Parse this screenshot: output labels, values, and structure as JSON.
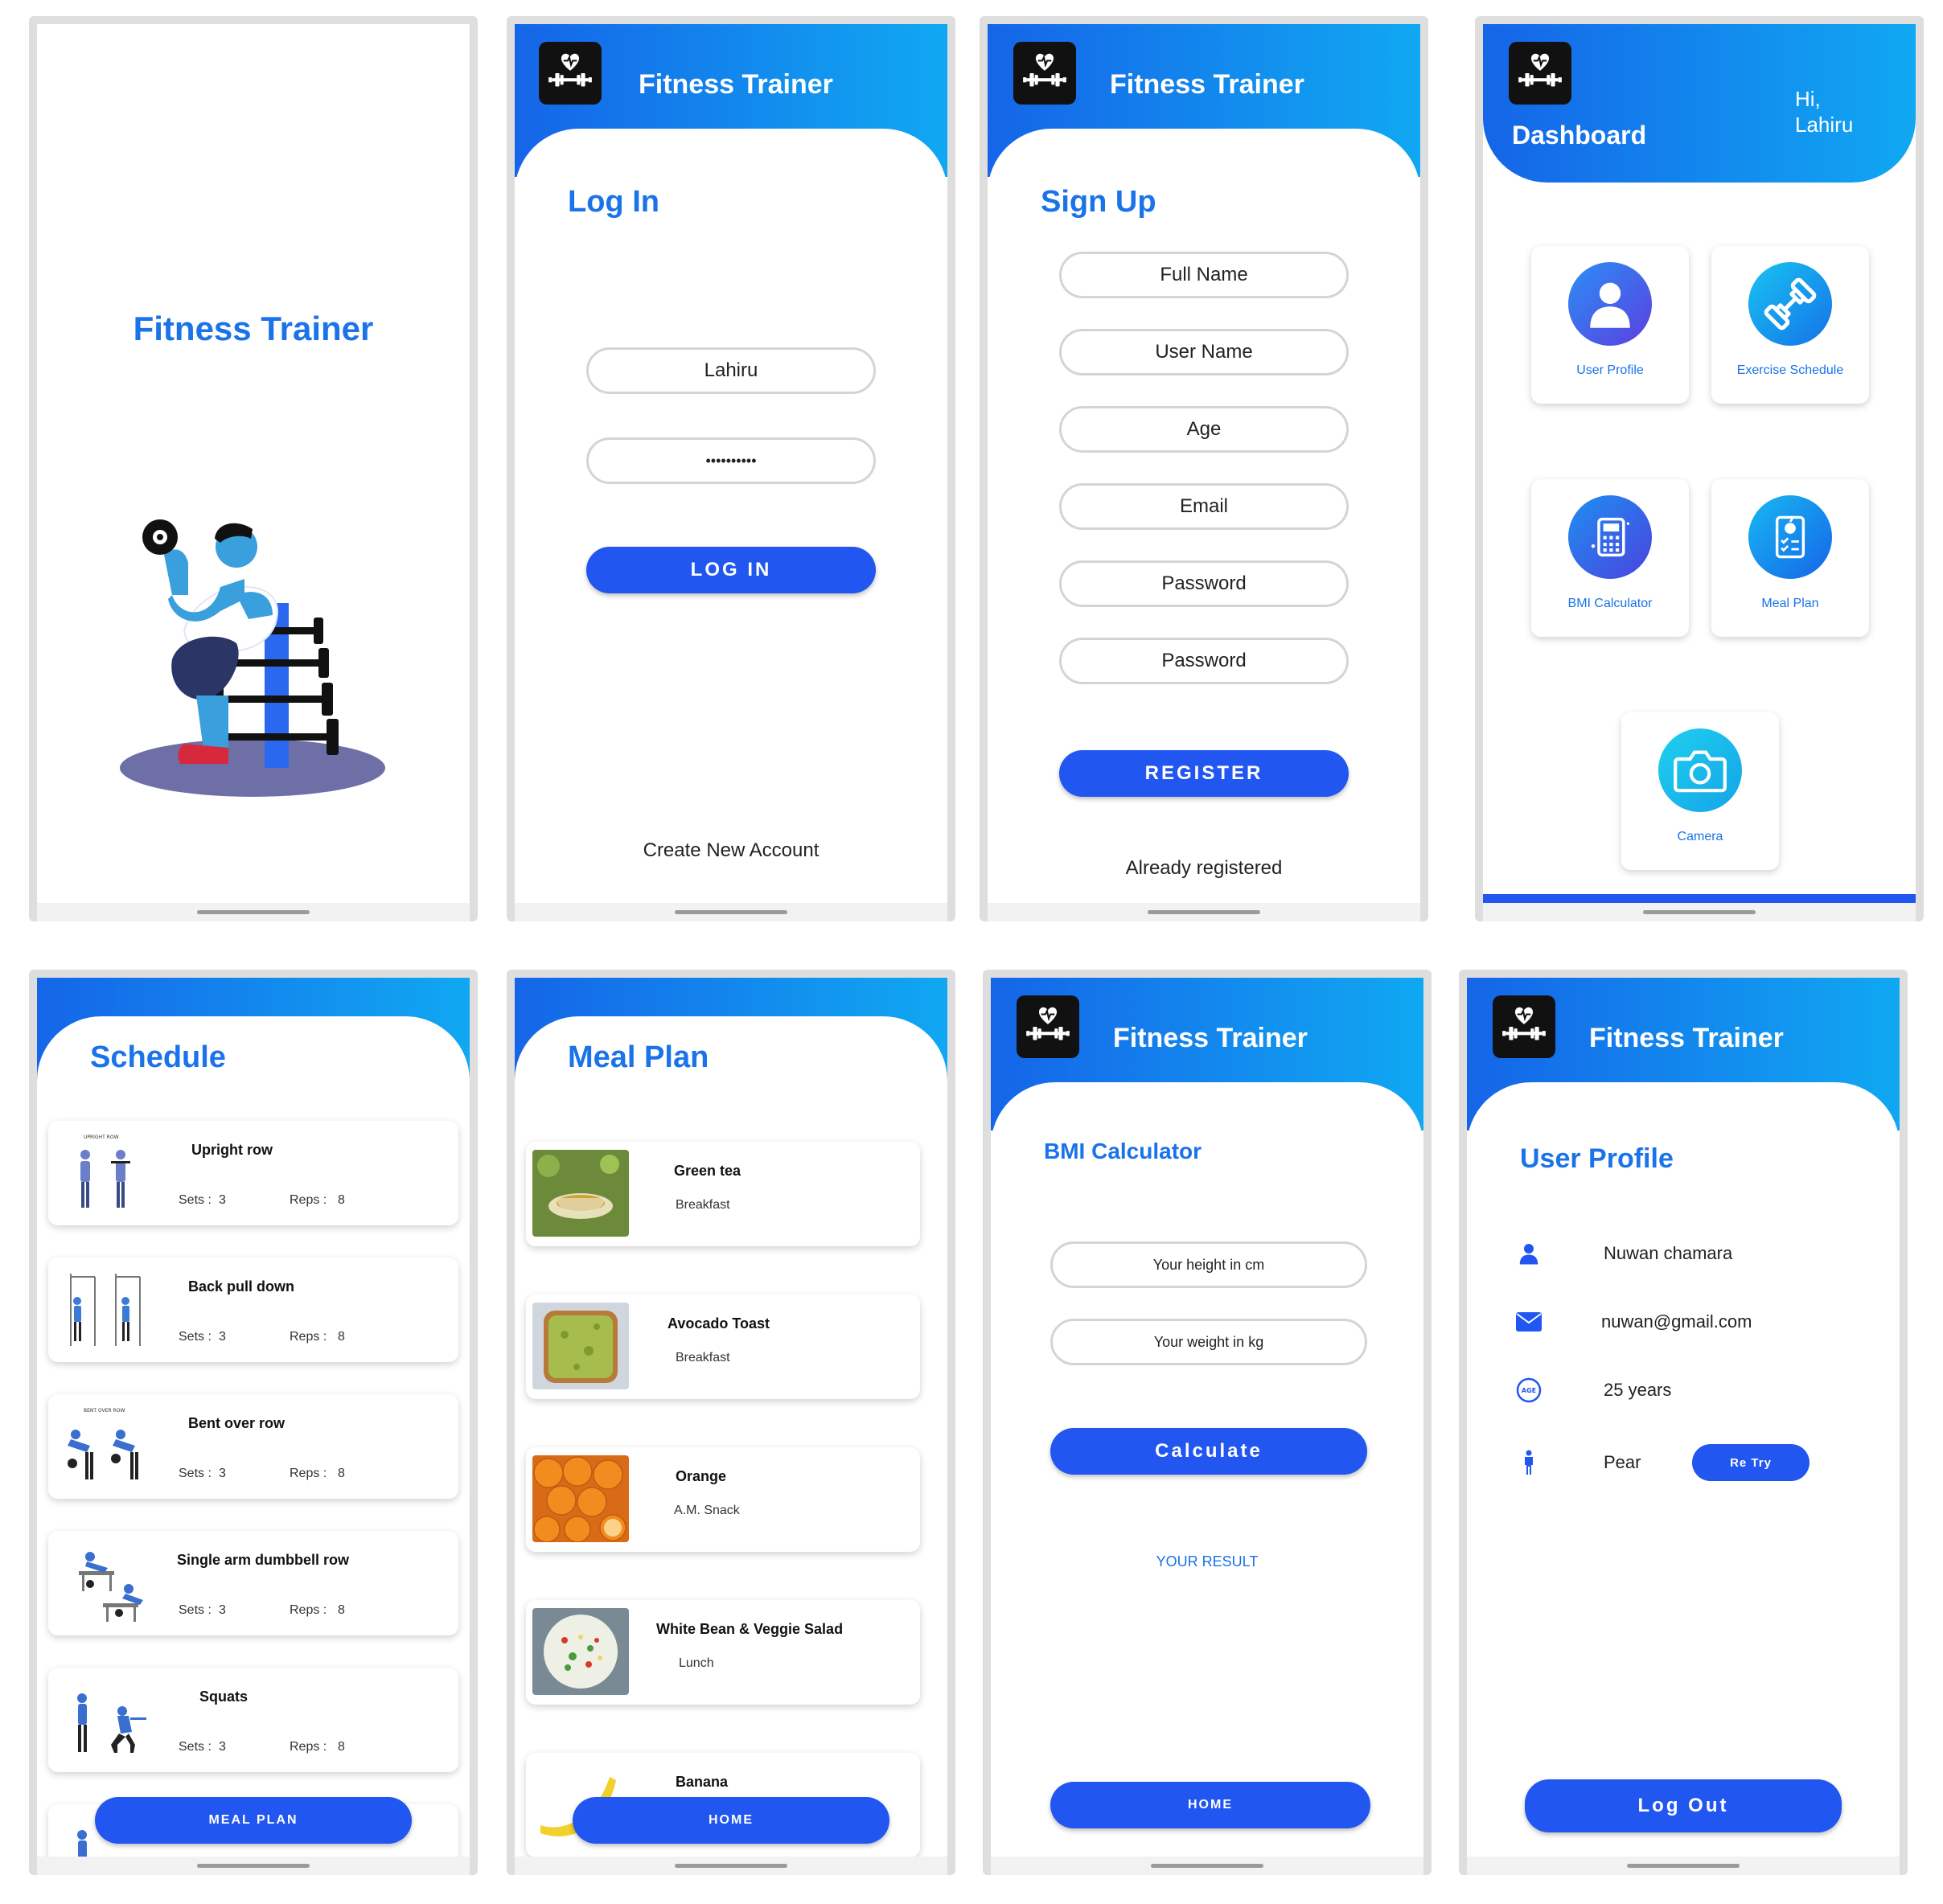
{
  "app_title": "Fitness Trainer",
  "colors": {
    "brand_blue": "#1a73e8",
    "button_blue": "#2156f0",
    "gradient_start": "#1565e8",
    "gradient_end": "#10a8f2"
  },
  "splash": {
    "title": "Fitness Trainer",
    "illustration": "man-lifting-dumbbell-illustration"
  },
  "login": {
    "heading": "Log In",
    "username_value": "Lahiru",
    "password_value": "••••••••••",
    "login_button": "LOG IN",
    "create_account": "Create New Account"
  },
  "signup": {
    "heading": "Sign Up",
    "fields": [
      "Full Name",
      "User Name",
      "Age",
      "Email",
      "Password",
      "Password"
    ],
    "register_button": "REGISTER",
    "already_registered": "Already registered"
  },
  "dashboard": {
    "title": "Dashboard",
    "greeting_hi": "Hi,",
    "greeting_name": "Lahiru",
    "tiles": [
      {
        "label": "User Profile",
        "icon": "user-icon"
      },
      {
        "label": "Exercise Schedule",
        "icon": "dumbbell-icon"
      },
      {
        "label": "BMI Calculator",
        "icon": "calculator-icon"
      },
      {
        "label": "Meal Plan",
        "icon": "clipboard-apple-icon"
      },
      {
        "label": "Camera",
        "icon": "camera-icon"
      }
    ]
  },
  "schedule": {
    "heading": "Schedule",
    "sets_label": "Sets :",
    "reps_label": "Reps :",
    "items": [
      {
        "name": "Upright row",
        "sets": "3",
        "reps": "8",
        "caption": "UPRIGHT ROW"
      },
      {
        "name": "Back pull down",
        "sets": "3",
        "reps": "8"
      },
      {
        "name": "Bent over row",
        "sets": "3",
        "reps": "8",
        "caption": "BENT OVER ROW"
      },
      {
        "name": "Single arm dumbbell row",
        "sets": "3",
        "reps": "8"
      },
      {
        "name": "Squats",
        "sets": "3",
        "reps": "8"
      }
    ],
    "bottom_button": "MEAL PLAN"
  },
  "meal_plan": {
    "heading": "Meal Plan",
    "items": [
      {
        "name": "Green tea",
        "meal": "Breakfast"
      },
      {
        "name": "Avocado Toast",
        "meal": "Breakfast"
      },
      {
        "name": "Orange",
        "meal": "A.M. Snack"
      },
      {
        "name": "White Bean & Veggie Salad",
        "meal": "Lunch"
      },
      {
        "name": "Banana",
        "meal": ""
      }
    ],
    "bottom_button": "HOME"
  },
  "bmi": {
    "heading": "BMI Calculator",
    "height_placeholder": "Your height in cm",
    "weight_placeholder": "Your weight in kg",
    "calculate_button": "Calculate",
    "result_label": "YOUR RESULT",
    "home_button": "HOME"
  },
  "profile": {
    "heading": "User Profile",
    "name": "Nuwan chamara",
    "email": "nuwan@gmail.com",
    "age": "25 years",
    "age_icon_text": "AGE",
    "body_type": "Pear",
    "retry_button": "Re Try",
    "logout_button": "Log Out"
  }
}
